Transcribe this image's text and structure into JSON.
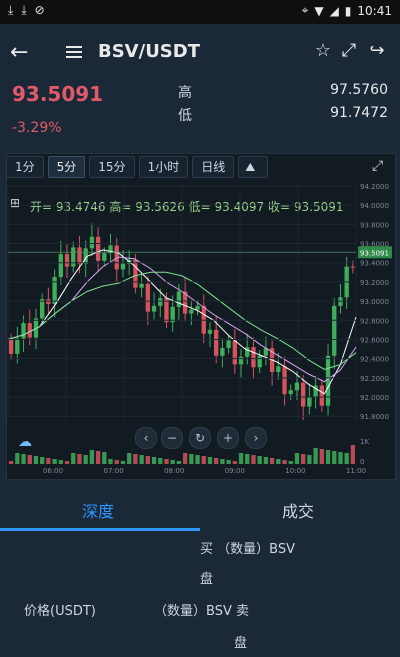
{
  "status": {
    "time": "10:41"
  },
  "header": {
    "pair": "BSV/USDT"
  },
  "ticker": {
    "last_price": "93.5091",
    "change": "-3.29%",
    "high_label": "高",
    "high_value": "97.5760",
    "low_label": "低",
    "low_value": "91.7472"
  },
  "timeframes": [
    "1分",
    "5分",
    "15分",
    "1小时",
    "日线"
  ],
  "active_timeframe": "5分",
  "ohlc": {
    "open": "开= 93.4746",
    "high": "高= 93.5626",
    "low": "低= 93.4097",
    "close": "收= 93.5091"
  },
  "price_marker": "93.5091",
  "chart_data": {
    "type": "line",
    "x_ticks": [
      "06:00",
      "07:00",
      "08:00",
      "09:00",
      "10:00",
      "11:00"
    ],
    "y_ticks": [
      "94.2000",
      "94.0000",
      "93.8000",
      "93.6000",
      "93.4000",
      "93.2000",
      "93.0000",
      "92.8000",
      "92.6000",
      "92.4000",
      "92.2000",
      "92.0000",
      "91.8000"
    ],
    "ylim": [
      91.75,
      94.2
    ],
    "volume_ticks": [
      "1K",
      "0"
    ],
    "series": [
      {
        "values": [
          92.6,
          92.7,
          92.9,
          93.3,
          93.5,
          93.6,
          93.5,
          93.4,
          93.2,
          93.0,
          92.9,
          93.0,
          92.8,
          92.6,
          92.5,
          92.4,
          92.4,
          92.3,
          92.1,
          92.0,
          92.0,
          93.0,
          93.5
        ]
      }
    ]
  },
  "tabs": {
    "depth": "深度",
    "trades": "成交"
  },
  "orderbook": {
    "buy_label_line1": "买  （数量）BSV",
    "buy_label_line2": "盘",
    "price_label": "价格(USDT)",
    "sell_label_line1": "（数量）BSV  卖",
    "sell_label_line2": "盘"
  }
}
